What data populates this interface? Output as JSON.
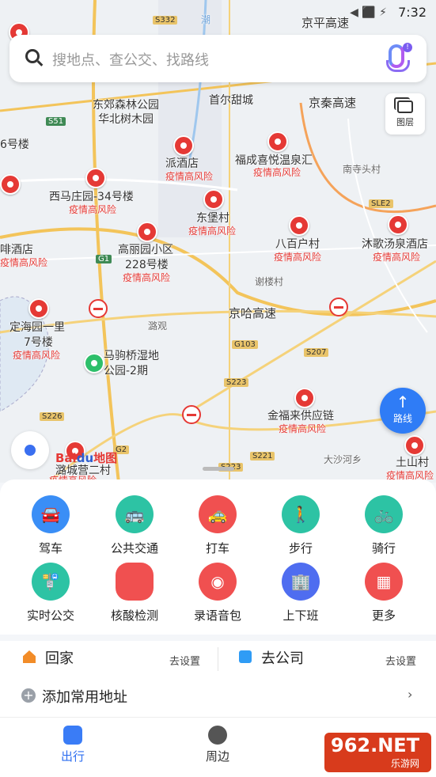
{
  "status": {
    "time": "7:32",
    "icons": "◀ ⬛ ⚡"
  },
  "search": {
    "placeholder": "搜地点、查公交、找路线"
  },
  "map": {
    "labels": [
      "京平高速",
      "首尔甜城",
      "京秦高速",
      "东郊森林公园",
      "华北树木园",
      "派酒店",
      "福成喜悦温泉汇",
      "南寺头村",
      "西马庄园-34号楼",
      "东堡村",
      "八百户村",
      "沐歌汤泉酒店",
      "高丽园小区",
      "228号楼",
      "谢楼村",
      "京哈高速",
      "定海园一里",
      "7号楼",
      "潞观",
      "马驹桥湿地",
      "公园-2期",
      "金福来供应链",
      "大沙河乡",
      "土山村",
      "6号楼",
      "啡酒店",
      "潞城营二村"
    ],
    "risk_text": "疫情高风险",
    "shields": [
      "S332",
      "S51",
      "G1",
      "G103",
      "S207",
      "S223",
      "S226",
      "S221",
      "G2",
      "SLE2",
      "S223",
      "潮"
    ]
  },
  "layers_label": "图层",
  "route_label": "路线",
  "logo": {
    "bai": "Bai",
    "du": "du",
    "map": "地图"
  },
  "grid": [
    {
      "label": "驾车",
      "color": "#3a8ef6",
      "glyph": "🚘"
    },
    {
      "label": "公共交通",
      "color": "#2dc3a4",
      "glyph": "🚌"
    },
    {
      "label": "打车",
      "color": "#f05050",
      "glyph": "🚕"
    },
    {
      "label": "步行",
      "color": "#2dc3a4",
      "glyph": "🚶"
    },
    {
      "label": "骑行",
      "color": "#2dc3a4",
      "glyph": "🚲"
    },
    {
      "label": "实时公交",
      "color": "#2dc3a4",
      "glyph": "🚏"
    },
    {
      "label": "核酸检测",
      "color": "#f05050",
      "glyph": ""
    },
    {
      "label": "录语音包",
      "color": "#f05050",
      "glyph": "◉"
    },
    {
      "label": "上下班",
      "color": "#4f6df0",
      "glyph": "🏢"
    },
    {
      "label": "更多",
      "color": "#f05050",
      "glyph": "▦"
    }
  ],
  "common": {
    "home": "回家",
    "company": "去公司",
    "set": "去设置",
    "add": "添加常用地址",
    "plus": "+",
    "chevron": "›"
  },
  "tabs": {
    "travel": "出行",
    "nearby": "周边"
  },
  "watermark": {
    "big": "962.NET",
    "sm": "乐游网"
  }
}
